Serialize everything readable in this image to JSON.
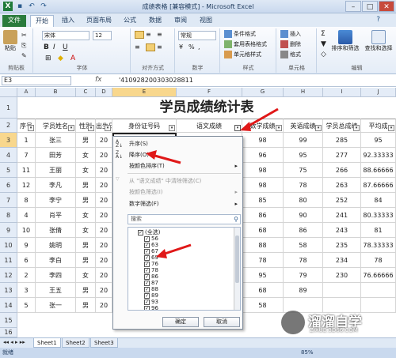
{
  "window": {
    "title": "成绩表格 [兼容模式] - Microsoft Excel",
    "file_tab": "文件",
    "tabs": [
      "开始",
      "插入",
      "页面布局",
      "公式",
      "数据",
      "审阅",
      "视图"
    ]
  },
  "ribbon": {
    "paste": "粘贴",
    "clipboard": "剪贴板",
    "font_name": "宋体",
    "font_size": "12",
    "font_group": "字体",
    "align_group": "对齐方式",
    "number_format": "常规",
    "number_group": "数字",
    "cond_format": "条件格式",
    "table_format": "套用表格格式",
    "cell_style": "单元格样式",
    "style_group": "样式",
    "insert": "插入",
    "delete": "删除",
    "format": "格式",
    "cells_group": "单元格",
    "sort_filter": "排序和筛选",
    "find_select": "查找和选择",
    "edit_group": "编辑"
  },
  "formula_bar": {
    "name_box": "E3",
    "fx": "fx",
    "formula": "'410928200303028811"
  },
  "sheet": {
    "columns": [
      "A",
      "B",
      "C",
      "D",
      "E",
      "F",
      "G",
      "H",
      "I",
      "J"
    ],
    "title": "学员成绩统计表",
    "headers": [
      "序号",
      "学员姓名",
      "性别",
      "出生日期",
      "身份证号码",
      "语文成绩",
      "数学成绩",
      "英语成绩",
      "学员总成绩",
      "平均成"
    ],
    "row_numbers": [
      "1",
      "2",
      "3",
      "4",
      "5",
      "6",
      "7",
      "8",
      "9",
      "10",
      "11",
      "12",
      "13",
      "14",
      "15",
      "16"
    ],
    "rows": [
      {
        "seq": "1",
        "name": "张三",
        "sex": "男",
        "birth": "20",
        "math": "98",
        "eng": "99",
        "total": "285",
        "avg": "95"
      },
      {
        "seq": "7",
        "name": "田芳",
        "sex": "女",
        "birth": "20",
        "math": "96",
        "eng": "95",
        "total": "277",
        "avg": "92.33333"
      },
      {
        "seq": "11",
        "name": "王丽",
        "sex": "女",
        "birth": "20",
        "math": "98",
        "eng": "75",
        "total": "266",
        "avg": "88.66666"
      },
      {
        "seq": "12",
        "name": "李凡",
        "sex": "男",
        "birth": "20",
        "math": "98",
        "eng": "78",
        "total": "263",
        "avg": "87.66666"
      },
      {
        "seq": "8",
        "name": "李宁",
        "sex": "男",
        "birth": "20",
        "math": "85",
        "eng": "80",
        "total": "252",
        "avg": "84"
      },
      {
        "seq": "4",
        "name": "肖平",
        "sex": "女",
        "birth": "20",
        "math": "86",
        "eng": "90",
        "total": "241",
        "avg": "80.33333"
      },
      {
        "seq": "10",
        "name": "张倩",
        "sex": "女",
        "birth": "20",
        "math": "68",
        "eng": "86",
        "total": "243",
        "avg": "81"
      },
      {
        "seq": "9",
        "name": "姚明",
        "sex": "男",
        "birth": "20",
        "math": "88",
        "eng": "58",
        "total": "235",
        "avg": "78.33333"
      },
      {
        "seq": "6",
        "name": "李白",
        "sex": "男",
        "birth": "20",
        "math": "78",
        "eng": "78",
        "total": "234",
        "avg": "78"
      },
      {
        "seq": "2",
        "name": "李四",
        "sex": "女",
        "birth": "20",
        "math": "95",
        "eng": "79",
        "total": "230",
        "avg": "76.66666"
      },
      {
        "seq": "3",
        "name": "王五",
        "sex": "男",
        "birth": "20",
        "math": "68",
        "eng": "89",
        "total": "",
        "avg": ""
      },
      {
        "seq": "5",
        "name": "张一",
        "sex": "男",
        "birth": "20",
        "math": "58",
        "eng": "",
        "total": "",
        "avg": ""
      }
    ]
  },
  "filter_menu": {
    "sort_asc": "升序(S)",
    "sort_desc": "降序(O)",
    "sort_color": "按颜色排序(T)",
    "clear_filter": "从 \"语文成绩\" 中清除筛选(C)",
    "filter_color": "按颜色筛选(I)",
    "number_filter": "数字筛选(F)",
    "search_placeholder": "搜索",
    "values": [
      "(全选)",
      "56",
      "63",
      "67",
      "69",
      "76",
      "78",
      "86",
      "87",
      "88",
      "89",
      "93",
      "96"
    ],
    "ok": "确定",
    "cancel": "取消"
  },
  "sheet_tabs": [
    "Sheet1",
    "Sheet2",
    "Sheet3"
  ],
  "status": {
    "ready": "就绪",
    "zoom": "85%"
  },
  "watermark": {
    "brand": "溜溜自学",
    "url": "ZIXUE.3D66.COM"
  }
}
